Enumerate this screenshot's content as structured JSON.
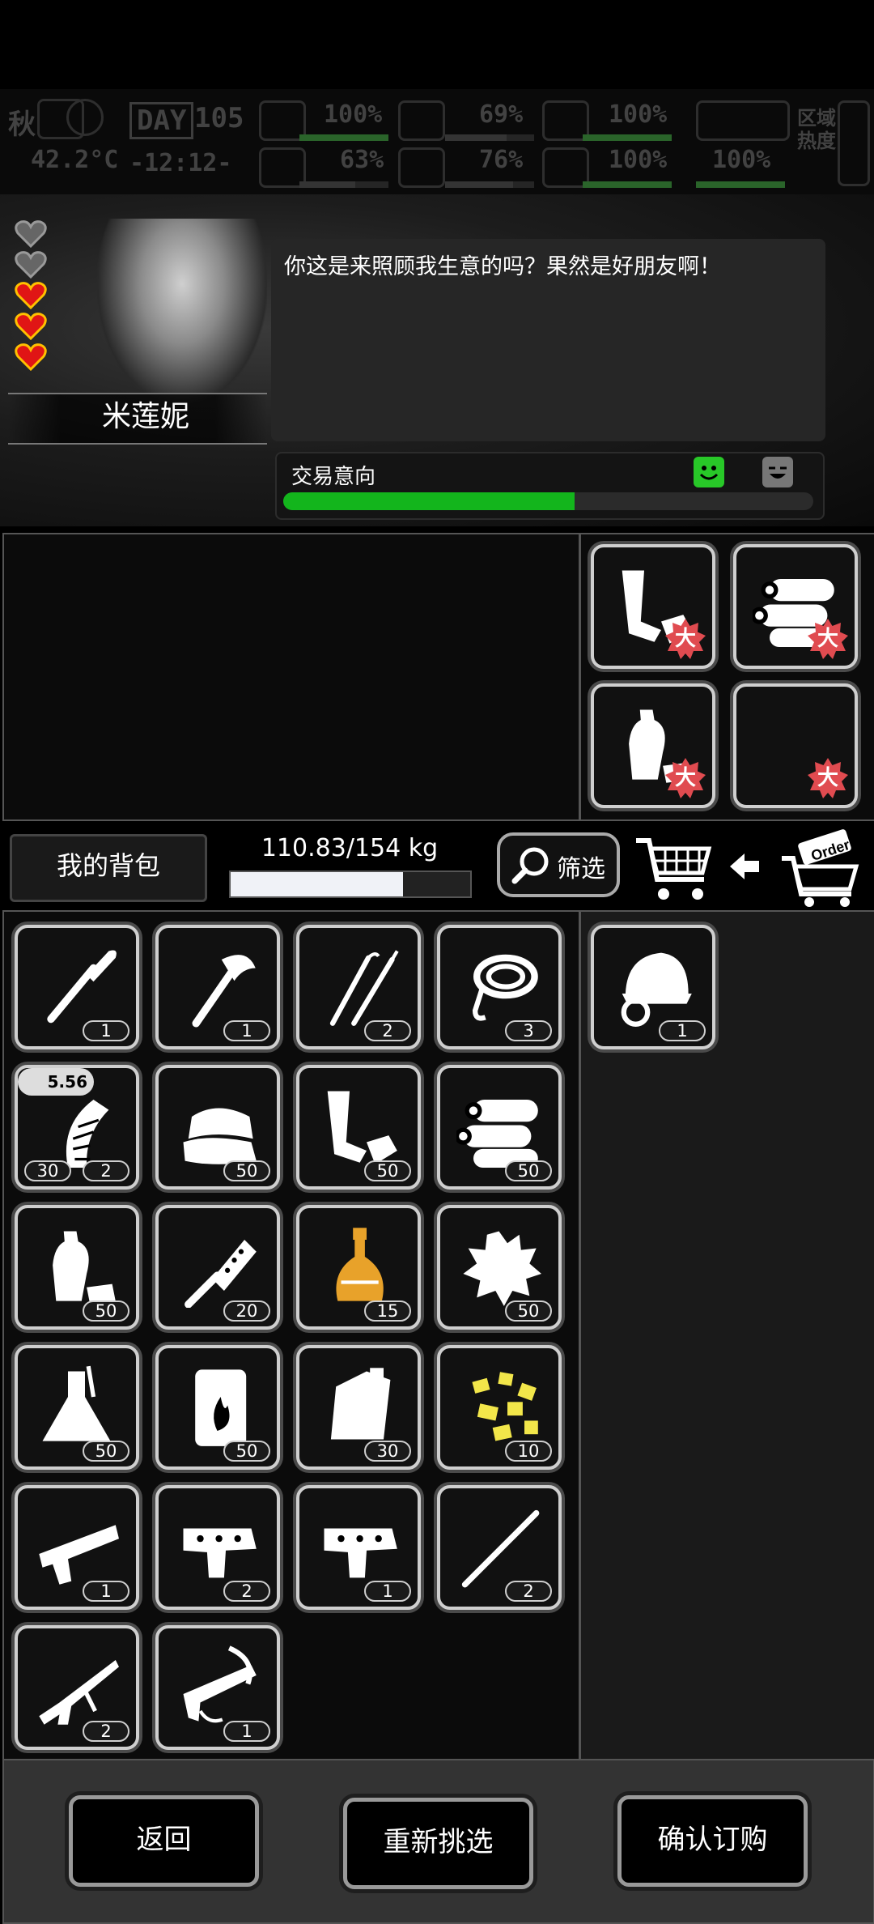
{
  "status": {
    "season": "秋",
    "day_label": "DAY",
    "day": "105",
    "temperature": "42.2°C",
    "time": "-12:12-",
    "stats": [
      "100%",
      "69%",
      "100%",
      "63%",
      "76%",
      "100%",
      "100%"
    ],
    "region_label": "区域热度"
  },
  "npc": {
    "name": "米莲妮",
    "dialogue": "你这是来照顾我生意的吗？果然是好朋友啊！",
    "hearts_total": 5,
    "hearts_filled": 3
  },
  "trade": {
    "intent_label": "交易意向",
    "intent_level": 0.55,
    "colors": {
      "fill": "#13b51c",
      "happy_face": "#28c828"
    }
  },
  "wanted_items": [
    {
      "icon": "pipe-scrap-icon",
      "badge": "大"
    },
    {
      "icon": "wood-logs-icon",
      "badge": "大"
    },
    {
      "icon": "plastic-bottles-icon",
      "badge": "大"
    },
    {
      "icon": "nails-icon",
      "badge": "大"
    }
  ],
  "toolbar": {
    "backpack_label": "我的背包",
    "weight": "110.83/154 kg",
    "weight_fraction": 0.72,
    "filter_label": "筛选",
    "order_label": "Order"
  },
  "inventory": [
    {
      "icon": "shovel-icon",
      "count": "1"
    },
    {
      "icon": "axe-icon",
      "count": "1"
    },
    {
      "icon": "lockpick-icon",
      "count": "2"
    },
    {
      "icon": "rope-icon",
      "count": "3"
    },
    {
      "icon": "rifle-magazine-icon",
      "count": "2",
      "ammo": "30",
      "caliber": "5.56"
    },
    {
      "icon": "cloth-icon",
      "count": "50"
    },
    {
      "icon": "pipe-scrap-icon",
      "count": "50"
    },
    {
      "icon": "wood-logs-icon",
      "count": "50"
    },
    {
      "icon": "plastic-bottles-icon",
      "count": "50"
    },
    {
      "icon": "spiked-bat-icon",
      "count": "20"
    },
    {
      "icon": "chemical-flask-icon",
      "count": "15"
    },
    {
      "icon": "fur-icon",
      "count": "50"
    },
    {
      "icon": "beaker-icon",
      "count": "50"
    },
    {
      "icon": "fuel-barrel-icon",
      "count": "50"
    },
    {
      "icon": "jerrycan-icon",
      "count": "30"
    },
    {
      "icon": "gold-nuggets-icon",
      "count": "10"
    },
    {
      "icon": "rifle-part-icon",
      "count": "1"
    },
    {
      "icon": "gun-receiver-icon",
      "count": "2"
    },
    {
      "icon": "gun-receiver-icon",
      "count": "1"
    },
    {
      "icon": "rod-icon",
      "count": "2"
    },
    {
      "icon": "shotgun-icon",
      "count": "2"
    },
    {
      "icon": "crossbow-icon",
      "count": "1"
    }
  ],
  "requested_items": [
    {
      "icon": "helmet-icon",
      "count": "1"
    }
  ],
  "buttons": {
    "back": "返回",
    "reselect": "重新挑选",
    "confirm": "确认订购"
  }
}
